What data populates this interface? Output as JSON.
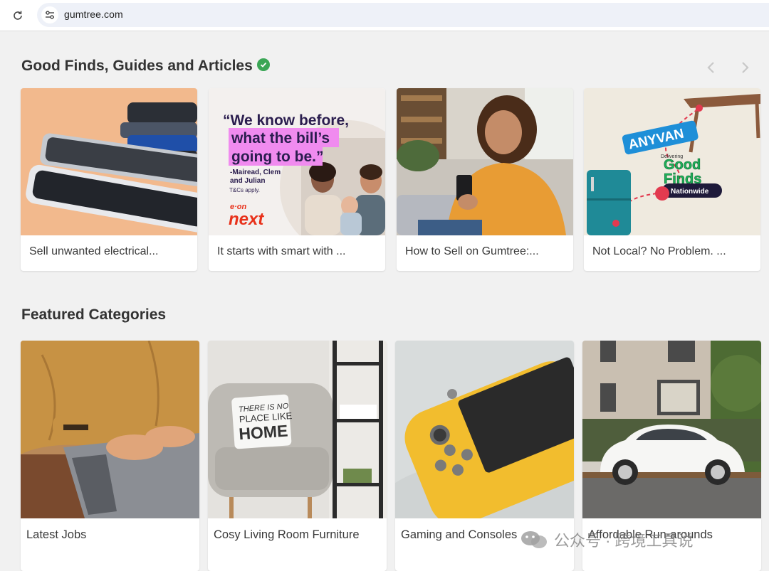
{
  "browser": {
    "url": "gumtree.com",
    "reload_icon": "reload-icon",
    "site_info_icon": "tune-icon"
  },
  "good_finds": {
    "title": "Good Finds, Guides and Articles",
    "verified_icon": "check-badge-icon",
    "cards": [
      {
        "caption": "Sell unwanted electrical..."
      },
      {
        "caption": "It starts with smart with ...",
        "ad": {
          "quote_line1": "“We know before,",
          "quote_line2": "what the bill’s",
          "quote_line3": "going to be.”",
          "attribution": "-Mairead, Clem and Julian",
          "tcs": "T&Cs apply.",
          "brand_top": "e·on",
          "brand_bottom": "next"
        }
      },
      {
        "caption": "How to Sell on Gumtree:..."
      },
      {
        "caption": "Not Local? No Problem. ...",
        "ad": {
          "brand": "ANYVAN",
          "delivering": "Delivering",
          "good": "Good",
          "finds": "Finds",
          "nationwide": "Nationwide"
        }
      }
    ]
  },
  "featured": {
    "title": "Featured Categories",
    "cards": [
      {
        "caption": "Latest Jobs"
      },
      {
        "caption": "Cosy Living Room Furniture",
        "pillow_line1": "THERE IS NO",
        "pillow_line2": "PLACE LIKE",
        "pillow_line3": "HOME"
      },
      {
        "caption": "Gaming and Consoles"
      },
      {
        "caption": "Affordable Run-arounds"
      }
    ]
  },
  "watermark": {
    "text": "公众号 · 跨境工具说"
  },
  "colors": {
    "accent_green": "#3aa655",
    "eon_red": "#e8311a",
    "anyvan_blue": "#1e8fd8",
    "goodfinds_green": "#1eb15a"
  }
}
